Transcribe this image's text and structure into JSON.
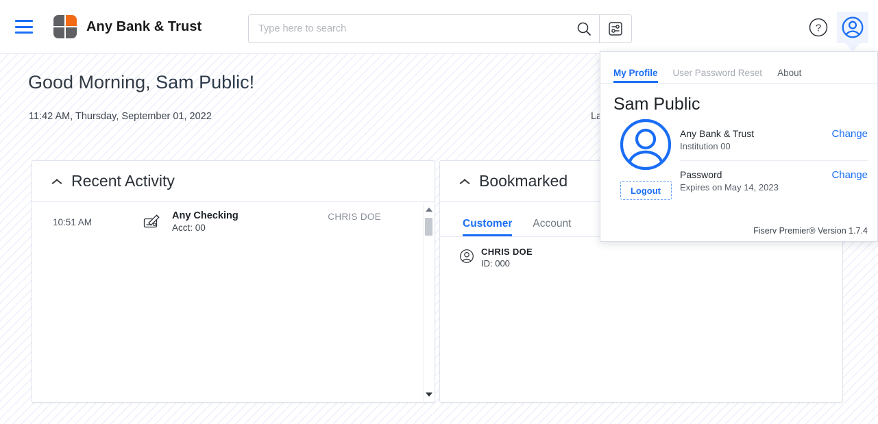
{
  "topbar": {
    "menu_icon": "hamburger-menu-icon",
    "brand_name": "Any Bank & Trust",
    "logo_icon": "any-bank-logo-icon",
    "search": {
      "placeholder": "Type here to search",
      "value": "",
      "search_icon": "search-icon",
      "filter_icon": "search-filter-icon"
    },
    "help_icon": "help-question-icon",
    "avatar_icon": "user-avatar-icon"
  },
  "main": {
    "greeting_prefix": "Good Morning, ",
    "greeting_user": "Sam Public!",
    "datetime": "11:42 AM, Thursday, September 01, 2022",
    "last_login_clipped": "Last Login"
  },
  "recent_activity": {
    "title": "Recent Activity",
    "collapse_icon": "chevron-up-icon",
    "rows": [
      {
        "time": "10:51 AM",
        "icon": "check-signing-icon",
        "account_name": "Any Checking",
        "account_number": "Acct: 00",
        "customer": "CHRIS DOE"
      }
    ],
    "scrollbar": {
      "up_arrow_icon": "scroll-up-arrow-icon",
      "down_arrow_icon": "scroll-down-arrow-icon"
    }
  },
  "bookmarked": {
    "title": "Bookmarked",
    "collapse_icon": "chevron-up-icon",
    "tabs": [
      {
        "label": "Customer",
        "active": true
      },
      {
        "label": "Account",
        "active": false
      }
    ],
    "items": [
      {
        "icon": "person-circle-icon",
        "name": "CHRIS DOE",
        "id": "ID: 000"
      }
    ]
  },
  "profile_popup": {
    "tabs": [
      {
        "label": "My Profile",
        "state": "active"
      },
      {
        "label": "User Password Reset",
        "state": "muted"
      },
      {
        "label": "About",
        "state": "dark"
      }
    ],
    "user_name": "Sam Public",
    "avatar_icon": "large-user-avatar-icon",
    "logout_label": "Logout",
    "rows": [
      {
        "title": "Any Bank & Trust",
        "subtitle": "Institution 00",
        "action": "Change"
      },
      {
        "title": "Password",
        "subtitle": "Expires on May 14, 2023",
        "action": "Change"
      }
    ],
    "version": "Fiserv Premier® Version 1.7.4"
  },
  "colors": {
    "accent_blue": "#1a6ef5",
    "logo_orange": "#f26a16",
    "logo_gray": "#5e6063",
    "muted_text": "#8a9099"
  }
}
